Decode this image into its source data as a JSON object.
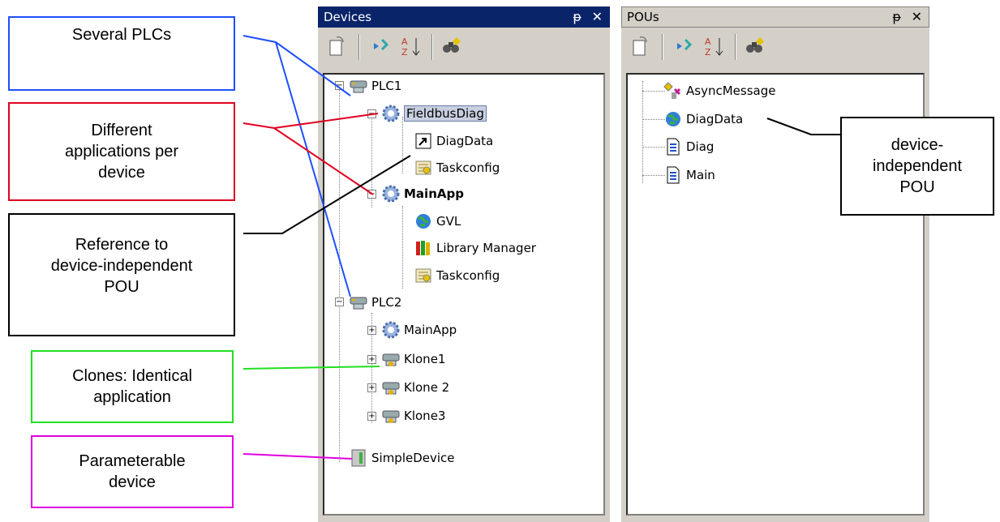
{
  "callouts": {
    "several_plcs": "Several PLCs",
    "different_apps": "Different\napplications per\ndevice",
    "reference": "Reference to\ndevice-independent\nPOU",
    "clones": "Clones: Identical\napplication",
    "parameterable": "Parameterable\ndevice",
    "device_independent": "device-\nindependent\nPOU"
  },
  "colors": {
    "several_plcs": "#1f4fff",
    "different_apps": "#e00020",
    "reference": "#000000",
    "clones": "#20e020",
    "parameterable": "#e000e0",
    "device_independent": "#000000"
  },
  "devices_panel": {
    "title": "Devices",
    "pin": "ᵽ",
    "close": "✕",
    "tree": {
      "plc1": "PLC1",
      "fieldbusdiag": "FieldbusDiag",
      "diagdata_ref": "DiagData",
      "taskconfig1": "Taskconfig",
      "mainapp1": "MainApp",
      "gvl": "GVL",
      "library_manager": "Library Manager",
      "taskconfig2": "Taskconfig",
      "plc2": "PLC2",
      "mainapp2": "MainApp",
      "klone1": "Klone1",
      "klone2": "Klone 2",
      "klone3": "Klone3",
      "simpledevice": "SimpleDevice"
    }
  },
  "pous_panel": {
    "title": "POUs",
    "pin": "ᵽ",
    "close": "✕",
    "tree": {
      "asyncmessage": "AsyncMessage",
      "diagdata": "DiagData",
      "diag": "Diag",
      "main": "Main"
    }
  }
}
